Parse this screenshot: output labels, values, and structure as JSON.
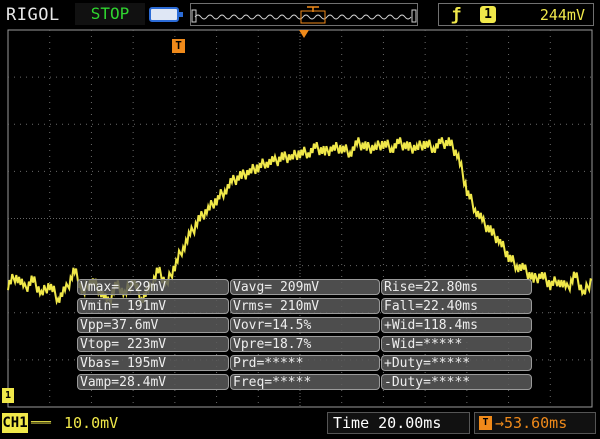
{
  "header": {
    "brand": "RIGOL",
    "run_state": "STOP",
    "trigger_channel": "1",
    "trigger_level": "244mV",
    "icons": {
      "usb": "usb-storage-icon",
      "memory": "memory-depth-icon",
      "trigger_edge": "rising-edge-icon"
    }
  },
  "markers": {
    "trigger_time": "T",
    "channel_ground": "1"
  },
  "measurements": [
    [
      "Vmax= 229mV",
      "Vavg= 209mV",
      "Rise=22.80ms"
    ],
    [
      "Vmin= 191mV",
      "Vrms= 210mV",
      "Fall=22.40ms"
    ],
    [
      "Vpp=37.6mV",
      "Vovr=14.5%",
      "+Wid=118.4ms"
    ],
    [
      "Vtop= 223mV",
      "Vpre=18.7%",
      "-Wid=*****"
    ],
    [
      "Vbas= 195mV",
      "Prd=*****",
      "+Duty=*****"
    ],
    [
      "Vamp=28.4mV",
      "Freq=*****",
      "-Duty=*****"
    ]
  ],
  "footer": {
    "channel": "CH1",
    "coupling": "DC",
    "channel_scale": "10.0mV",
    "timebase": "Time 20.00ms",
    "trigger_offset": "53.60ms"
  },
  "colors": {
    "channel1": "#f0e84a",
    "trigger": "#f08a1a",
    "run_state": "#2fd52f",
    "grid": "#6a6a6a"
  },
  "trace": [
    [
      -7,
      195
    ],
    [
      -6.8,
      197
    ],
    [
      -6.6,
      194
    ],
    [
      -6.4,
      196
    ],
    [
      -6.2,
      193
    ],
    [
      -6,
      195
    ],
    [
      -5.8,
      192
    ],
    [
      -5.6,
      194
    ],
    [
      -5.4,
      198
    ],
    [
      -5.2,
      193
    ],
    [
      -5,
      196
    ],
    [
      -4.8,
      194
    ],
    [
      -4.6,
      191
    ],
    [
      -4.4,
      195
    ],
    [
      -4.2,
      193
    ],
    [
      -4,
      196
    ],
    [
      -3.8,
      192
    ],
    [
      -3.6,
      194
    ],
    [
      -3.4,
      198
    ],
    [
      -3.2,
      195
    ],
    [
      -3,
      199
    ],
    [
      -2.8,
      203
    ],
    [
      -2.6,
      206
    ],
    [
      -2.4,
      209
    ],
    [
      -2.2,
      211
    ],
    [
      -2,
      213
    ],
    [
      -1.8,
      215
    ],
    [
      -1.6,
      217
    ],
    [
      -1.4,
      218
    ],
    [
      -1.2,
      219
    ],
    [
      -1,
      220
    ],
    [
      -0.8,
      221
    ],
    [
      -0.6,
      221
    ],
    [
      -0.4,
      222
    ],
    [
      -0.2,
      222
    ],
    [
      0,
      223
    ],
    [
      0.2,
      223
    ],
    [
      0.4,
      224
    ],
    [
      0.6,
      223
    ],
    [
      0.8,
      224
    ],
    [
      1,
      224
    ],
    [
      1.2,
      223
    ],
    [
      1.4,
      225
    ],
    [
      1.6,
      224
    ],
    [
      1.8,
      224
    ],
    [
      2,
      225
    ],
    [
      2.2,
      224
    ],
    [
      2.4,
      225
    ],
    [
      2.6,
      224
    ],
    [
      2.8,
      224
    ],
    [
      3,
      225
    ],
    [
      3.2,
      224
    ],
    [
      3.4,
      225
    ],
    [
      3.6,
      225
    ],
    [
      3.8,
      222
    ],
    [
      4,
      215
    ],
    [
      4.2,
      211
    ],
    [
      4.4,
      208
    ],
    [
      4.6,
      206
    ],
    [
      4.8,
      204
    ],
    [
      5,
      201
    ],
    [
      5.2,
      199
    ],
    [
      5.4,
      198
    ],
    [
      5.6,
      196
    ],
    [
      5.8,
      197
    ],
    [
      6,
      195
    ],
    [
      6.2,
      196
    ],
    [
      6.4,
      194
    ],
    [
      6.6,
      197
    ],
    [
      6.8,
      193
    ],
    [
      7,
      196
    ]
  ]
}
